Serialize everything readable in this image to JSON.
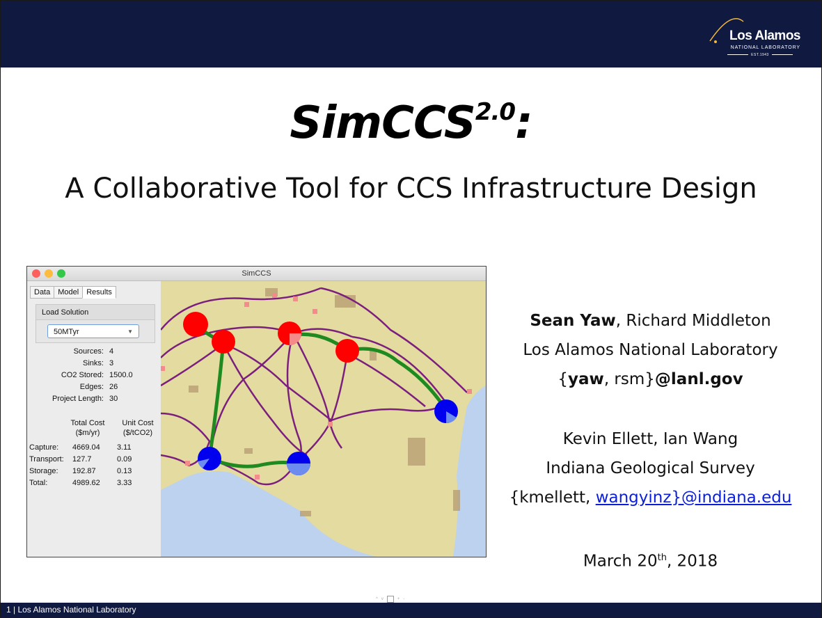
{
  "header": {
    "logo": {
      "name": "Los Alamos",
      "sub": "NATIONAL LABORATORY",
      "est": "EST.1943"
    }
  },
  "slide": {
    "title_main": "SimCCS",
    "title_sup": "2.0",
    "title_tail": ":",
    "subtitle": "A Collaborative Tool for CCS Infrastructure Design"
  },
  "app": {
    "window_title": "SimCCS",
    "tabs": [
      "Data",
      "Model",
      "Results"
    ],
    "active_tab": "Results",
    "load_solution_label": "Load Solution",
    "solution_select": "50MTyr",
    "stats": [
      {
        "k": "Sources:",
        "v": "4"
      },
      {
        "k": "Sinks:",
        "v": "3"
      },
      {
        "k": "CO2 Stored:",
        "v": "1500.0"
      },
      {
        "k": "Edges:",
        "v": "26"
      },
      {
        "k": "Project Length:",
        "v": "30"
      }
    ],
    "cost_headers": {
      "total": "Total Cost",
      "total_unit": "($m/yr)",
      "unit": "Unit Cost",
      "unit_unit": "($/tCO2)"
    },
    "costs": [
      {
        "label": "Capture:",
        "total": "4669.04",
        "unit": "3.11"
      },
      {
        "label": "Transport:",
        "total": "127.7",
        "unit": "0.09"
      },
      {
        "label": "Storage:",
        "total": "192.87",
        "unit": "0.13"
      },
      {
        "label": "Total:",
        "total": "4989.62",
        "unit": "3.33"
      }
    ],
    "colors": {
      "source": "#ff0000",
      "sink": "#0000ff",
      "candidate_edge": "#7b1f7e",
      "built_edge": "#1f8a1f",
      "land": "#e6dc9c",
      "water": "#bcd2ee"
    }
  },
  "authors": {
    "line1_bold": "Sean Yaw",
    "line1_rest": ", Richard Middleton",
    "line2": "Los Alamos National Laboratory",
    "email1_open": "{",
    "email1_bold": "yaw",
    "email1_mid": ", rsm}",
    "email1_domain": "@lanl.gov",
    "line4": "Kevin Ellett, Ian Wang",
    "line5": "Indiana Geological Survey",
    "email2_plain": "{kmellett, ",
    "email2_link": "wangyinz}@indiana.edu",
    "date_main": "March 20",
    "date_sup": "th",
    "date_tail": ", 2018"
  },
  "footer": {
    "text": "1 | Los Alamos National Laboratory"
  }
}
